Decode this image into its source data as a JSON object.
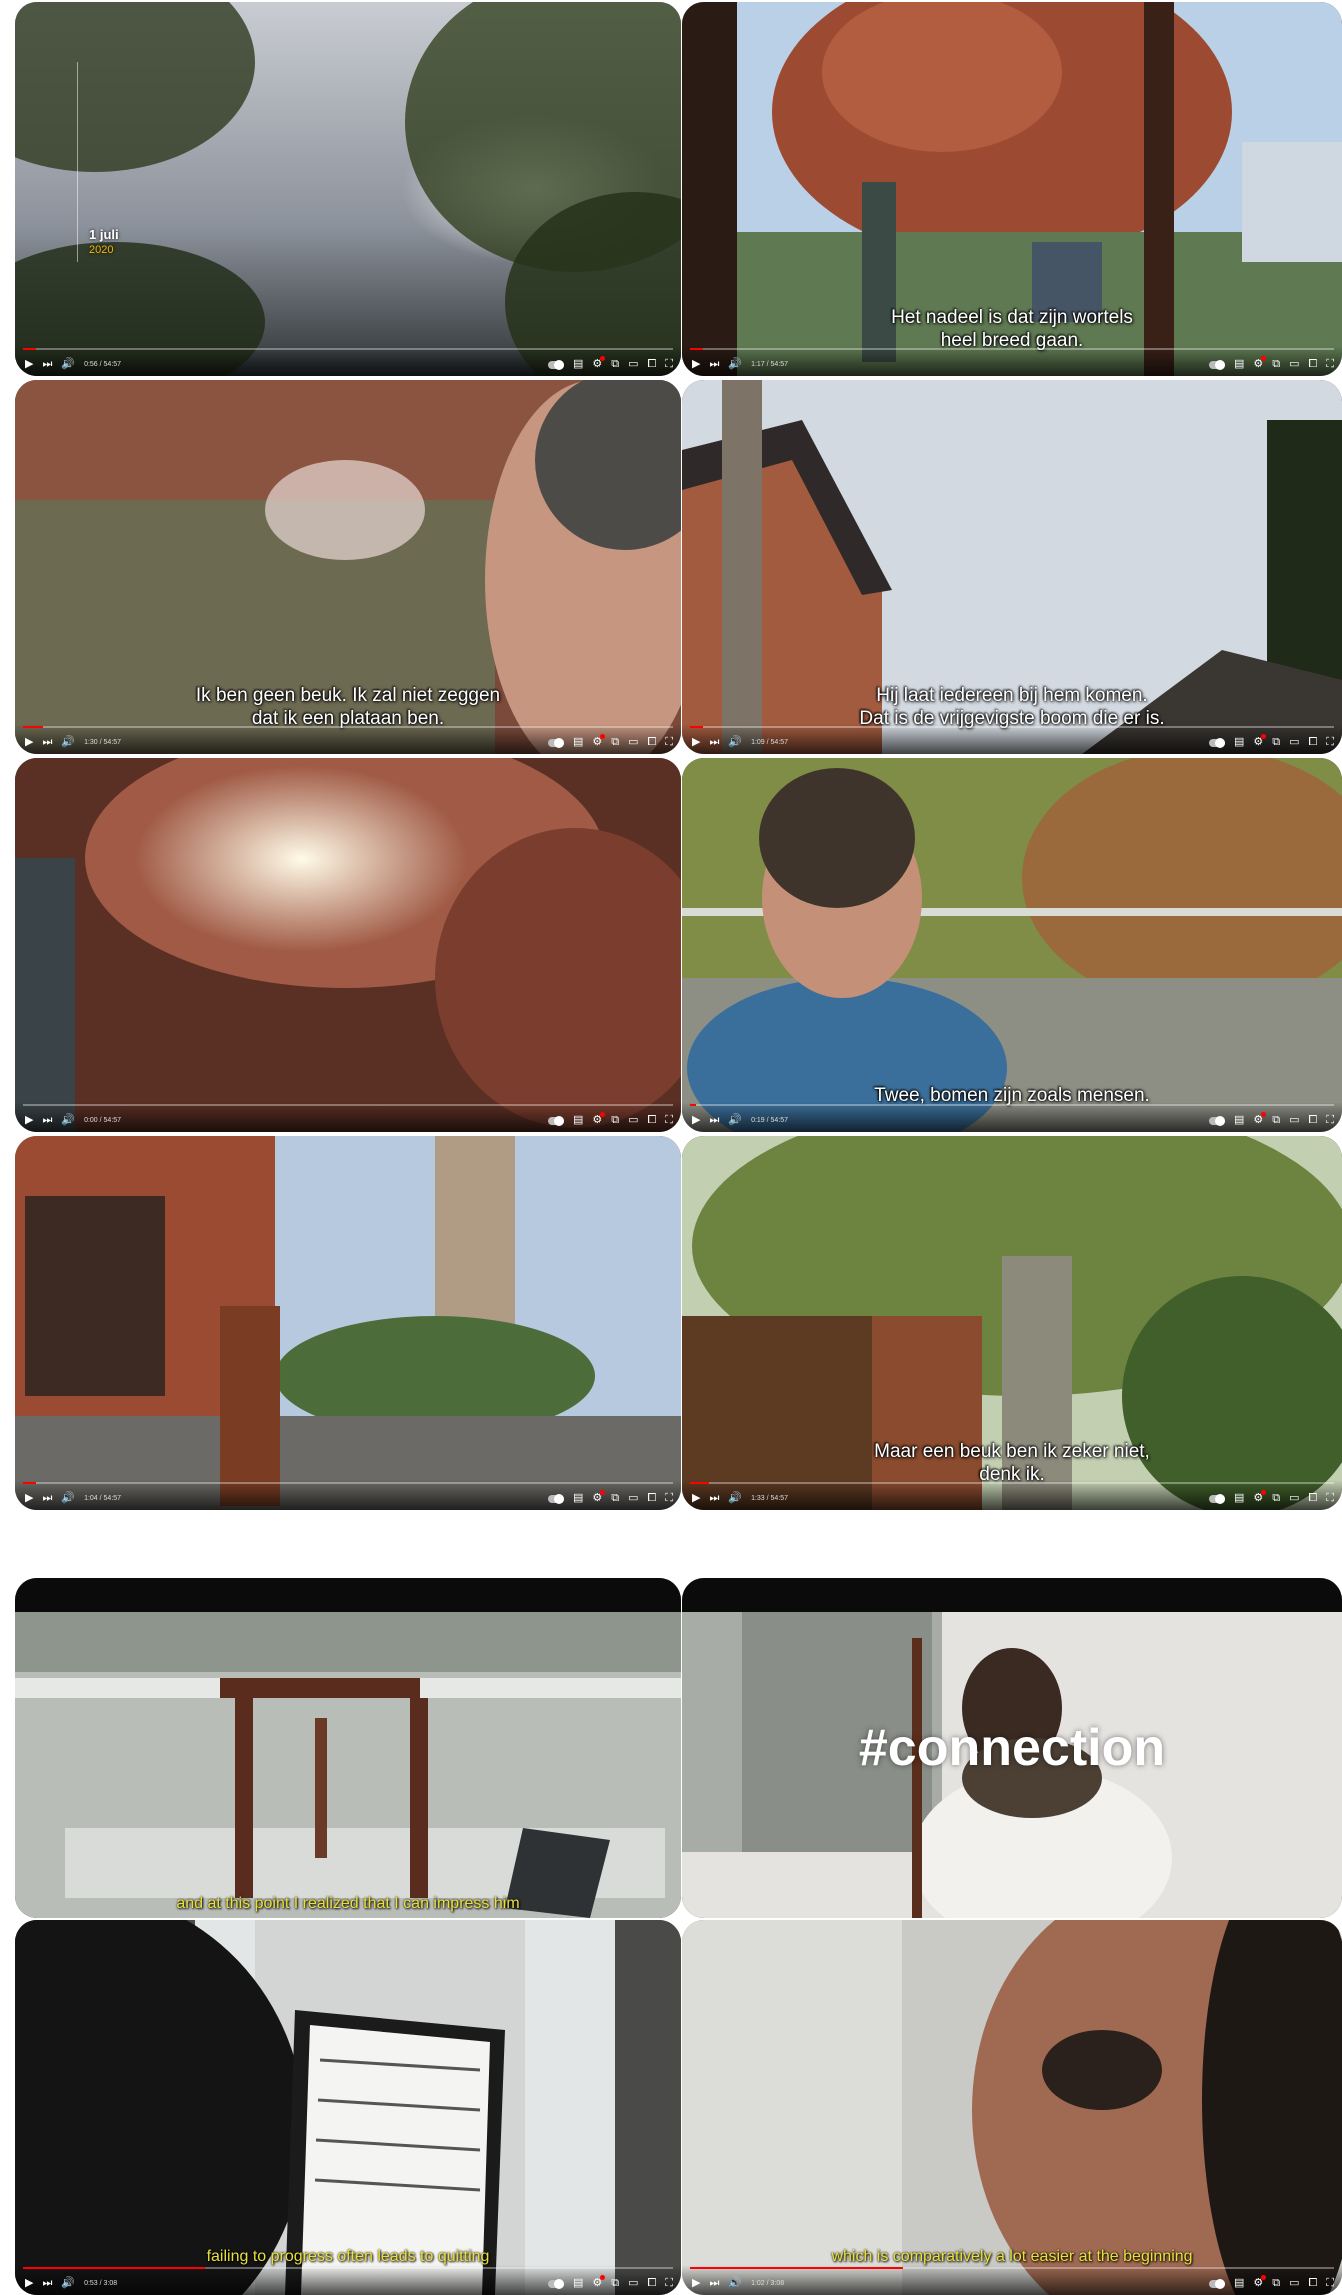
{
  "frames": [
    {
      "name": "frame-1",
      "time": "0:56 / 54:57",
      "progress": 0.02,
      "date_day": "1 juli",
      "date_year": "2020",
      "subtitle": []
    },
    {
      "name": "frame-2",
      "time": "1:17 / 54:57",
      "progress": 0.02,
      "subtitle": [
        "Het nadeel is dat zijn wortels",
        "heel breed gaan."
      ]
    },
    {
      "name": "frame-3",
      "time": "1:30 / 54:57",
      "progress": 0.03,
      "subtitle": [
        "Ik ben geen beuk. Ik zal niet zeggen",
        "dat ik een plataan ben."
      ]
    },
    {
      "name": "frame-4",
      "time": "1:09 / 54:57",
      "progress": 0.02,
      "subtitle": [
        "Hij laat iedereen bij hem komen.",
        "Dat is de vrijgevigste boom die er is."
      ]
    },
    {
      "name": "frame-5",
      "time": "0:00 / 54:57",
      "progress": 0.0,
      "subtitle": []
    },
    {
      "name": "frame-6",
      "time": "0:19 / 54:57",
      "progress": 0.01,
      "subtitle": [
        "Twee, bomen zijn zoals mensen."
      ]
    },
    {
      "name": "frame-7",
      "time": "1:04 / 54:57",
      "progress": 0.02,
      "subtitle": []
    },
    {
      "name": "frame-8",
      "time": "1:33 / 54:57",
      "progress": 0.03,
      "subtitle": [
        "Maar een beuk ben ik zeker niet,",
        "denk ik."
      ]
    },
    {
      "name": "frame-9",
      "subtitle": [
        "and at this point I realized that I can impress him"
      ]
    },
    {
      "name": "frame-10",
      "hashtag": "#connection",
      "subtitle": []
    },
    {
      "name": "frame-11",
      "time": "0:53 / 3:08",
      "progress": 0.28,
      "subtitle": [
        "failing to progress often leads to quitting"
      ]
    },
    {
      "name": "frame-12",
      "time": "1:02 / 3:08",
      "progress": 0.33,
      "subtitle": [
        "which is comparatively a lot easier at the beginning"
      ]
    }
  ],
  "icons": {
    "play": "▶",
    "next": "⏭",
    "volume": "🔊",
    "settings": "⚙",
    "subtitles": "▤",
    "miniplayer": "⧉",
    "theater": "▭",
    "cast": "⧠",
    "fullscreen": "⛶"
  },
  "colors": {
    "progress": "#ff0000",
    "subtitle_white": "#ffffff",
    "subtitle_yellow": "#e9e13a",
    "date_year": "#f2b705"
  }
}
